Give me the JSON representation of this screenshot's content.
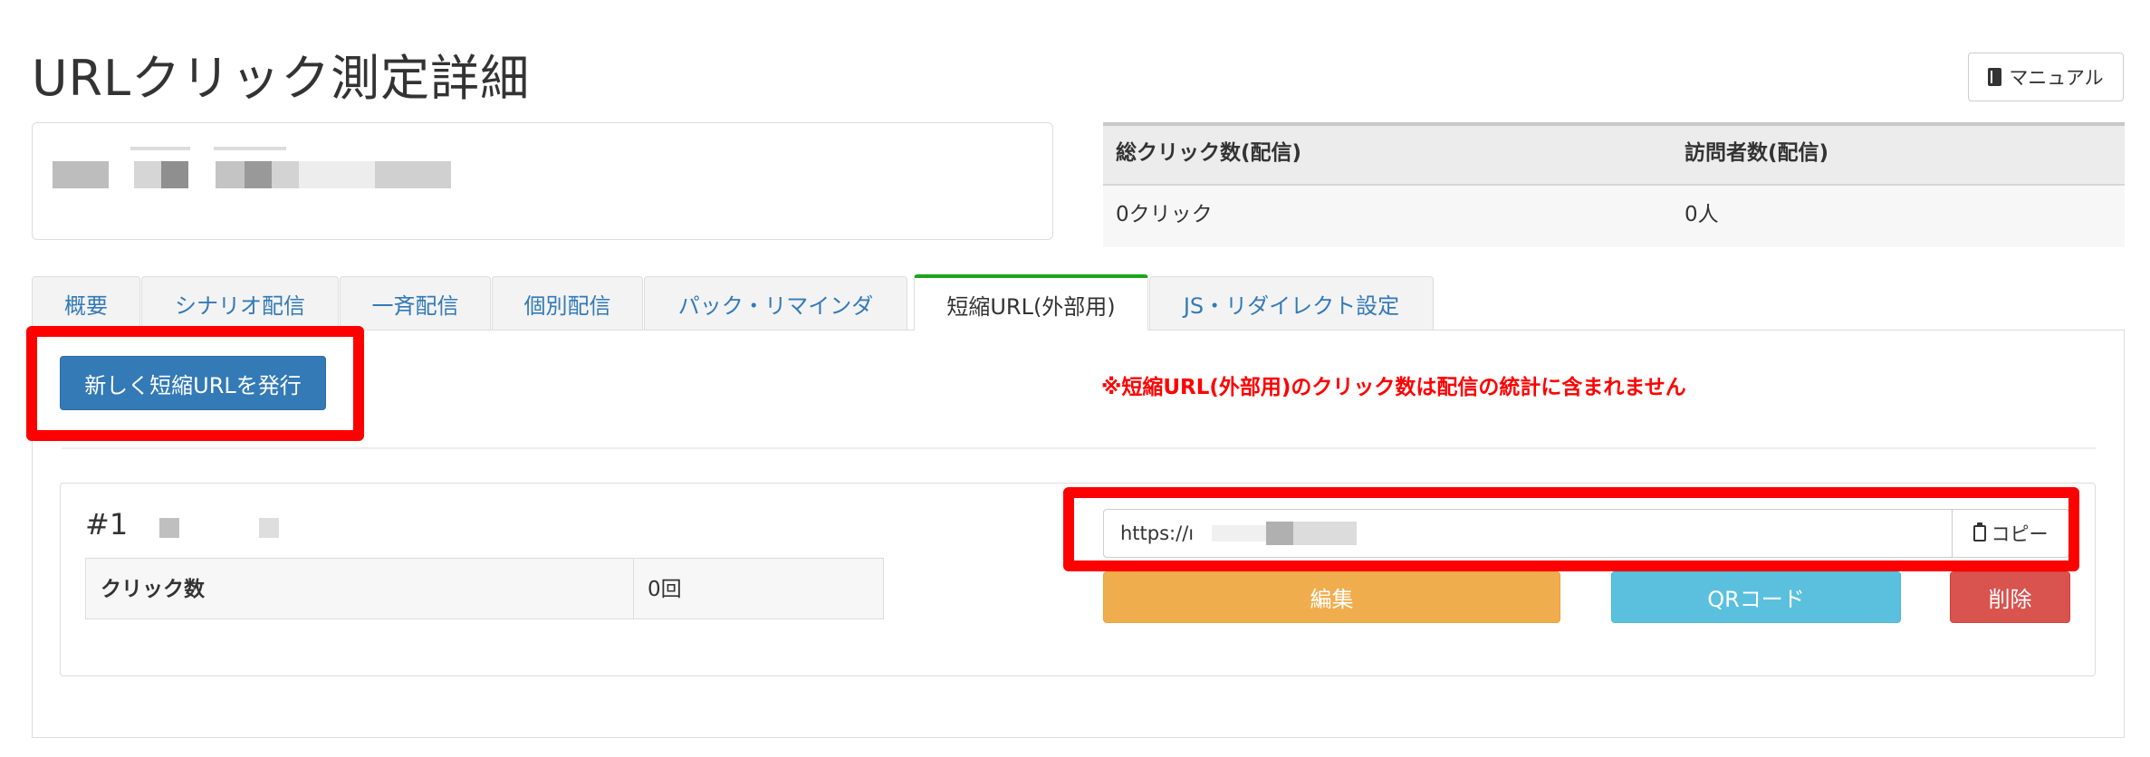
{
  "header": {
    "title": "URLクリック測定詳細",
    "manual_label": "マニュアル",
    "manual_icon": "book-icon"
  },
  "stats": {
    "headers": [
      "総クリック数(配信)",
      "訪問者数(配信)"
    ],
    "values": [
      "0クリック",
      "0人"
    ]
  },
  "tabs": [
    {
      "label": "概要"
    },
    {
      "label": "シナリオ配信"
    },
    {
      "label": "一斉配信"
    },
    {
      "label": "個別配信"
    },
    {
      "label": "パック・リマインダ"
    },
    {
      "label": "短縮URL(外部用)",
      "active": true
    },
    {
      "label": "JS・リダイレクト設定"
    }
  ],
  "toolbar": {
    "issue_label": "新しく短縮URLを発行",
    "notice": "※短縮URL(外部用)のクリック数は配信の統計に含まれません"
  },
  "url_card": {
    "number": "#1",
    "click_label": "クリック数",
    "click_value": "0回",
    "url_value": "https://ı",
    "copy_label": "コピー",
    "copy_icon": "clipboard-icon",
    "edit_label": "編集",
    "qr_label": "QRコード",
    "delete_label": "削除"
  },
  "colors": {
    "primary": "#337ab7",
    "warning": "#f0ad4e",
    "info": "#5bc0de",
    "danger": "#d9534f",
    "highlight": "#ff0000",
    "active_tab_border": "#1aa51a"
  }
}
